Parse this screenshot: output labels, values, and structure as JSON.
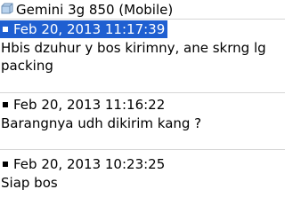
{
  "window": {
    "title": "Gemini 3g 850 (Mobile)",
    "icon": "folder-icon"
  },
  "messages": [
    {
      "timestamp": "Feb 20, 2013 11:17:39",
      "body": "Hbis dzuhur y bos kirimny, ane skrng lg packing",
      "selected": true
    },
    {
      "timestamp": "Feb 20, 2013 11:16:22",
      "body": "Barangnya udh dikirim kang ?",
      "selected": false
    },
    {
      "timestamp": "Feb 20, 2013 10:23:25",
      "body": "Siap bos",
      "selected": false
    }
  ],
  "colors": {
    "selection": "#1f5fd1",
    "divider": "#d6d6d6"
  }
}
